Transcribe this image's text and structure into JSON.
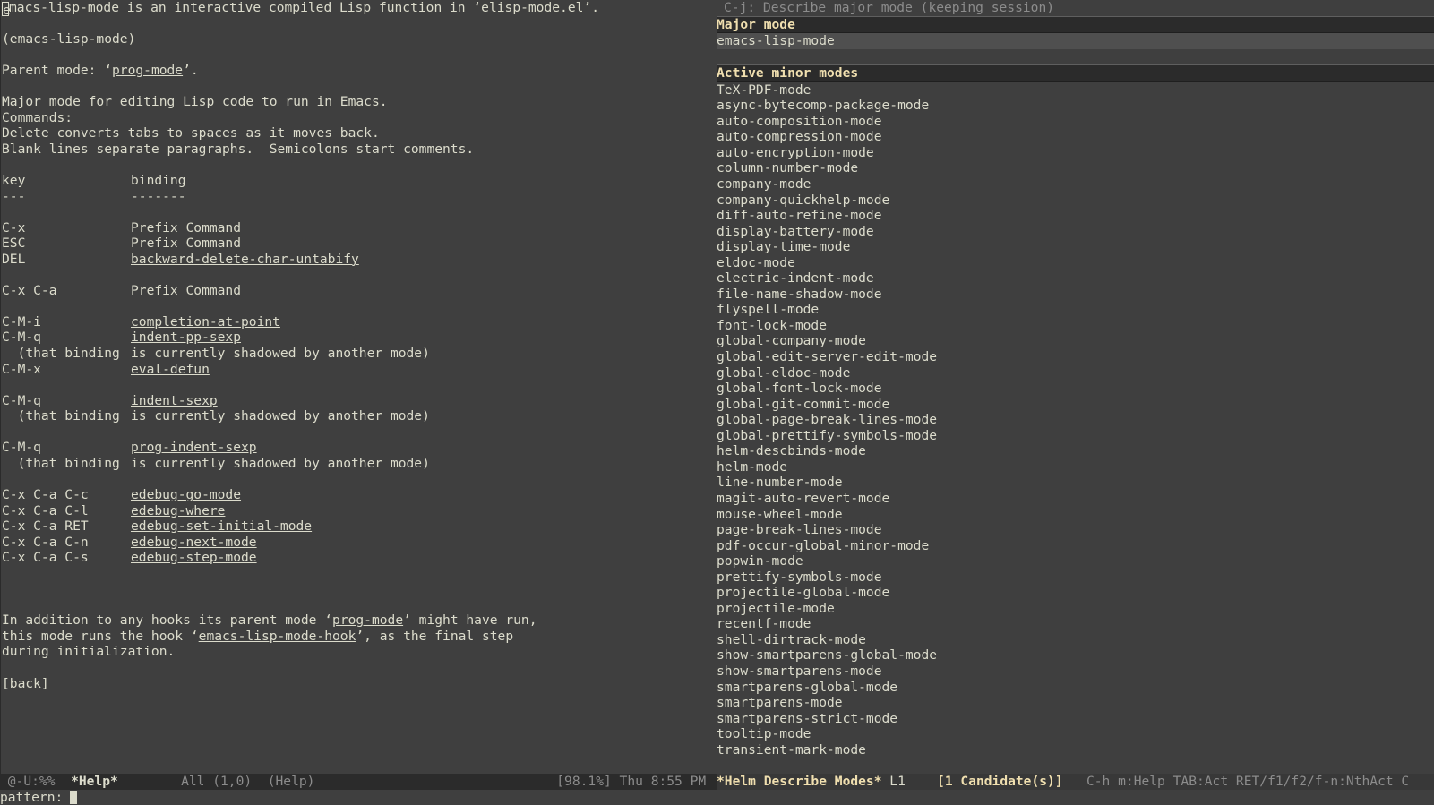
{
  "help": {
    "intro": {
      "cursor_char": "e",
      "pre": "macs-lisp-mode is an interactive compiled Lisp function in ‘",
      "file_link": "elisp-mode.el",
      "post": "’."
    },
    "signature": "(emacs-lisp-mode)",
    "parent": {
      "pre": "Parent mode: ‘",
      "link": "prog-mode",
      "post": "’."
    },
    "description": [
      "Major mode for editing Lisp code to run in Emacs.",
      "Commands:",
      "Delete converts tabs to spaces as it moves back.",
      "Blank lines separate paragraphs.  Semicolons start comments."
    ],
    "table_header": {
      "key": "key",
      "binding": "binding"
    },
    "table_rule": {
      "key": "---",
      "binding": "-------"
    },
    "rows": {
      "cx": {
        "key": "C-x",
        "binding": "Prefix Command"
      },
      "esc": {
        "key": "ESC",
        "binding": "Prefix Command"
      },
      "del": {
        "key": "DEL",
        "binding": "backward-delete-char-untabify"
      },
      "cxca": {
        "key": "C-x C-a",
        "binding": "Prefix Command"
      },
      "cmi": {
        "key": "C-M-i",
        "binding": "completion-at-point"
      },
      "cmq1": {
        "key": "C-M-q",
        "binding": "indent-pp-sexp"
      },
      "cmx": {
        "key": "C-M-x",
        "binding": "eval-defun"
      },
      "cmq2": {
        "key": "C-M-q",
        "binding": "indent-sexp"
      },
      "cmq3": {
        "key": "C-M-q",
        "binding": "prog-indent-sexp"
      },
      "cc": {
        "key": "C-x C-a C-c",
        "binding": "edebug-go-mode"
      },
      "cl": {
        "key": "C-x C-a C-l",
        "binding": "edebug-where"
      },
      "ret": {
        "key": "C-x C-a RET",
        "binding": "edebug-set-initial-mode"
      },
      "cn": {
        "key": "C-x C-a C-n",
        "binding": "edebug-next-mode"
      },
      "cs": {
        "key": "C-x C-a C-s",
        "binding": "edebug-step-mode"
      }
    },
    "shadow_note_left": "  (that binding",
    "shadow_note_right": "is currently shadowed by another mode)",
    "hooks": {
      "line1_pre": "In addition to any hooks its parent mode ‘",
      "line1_link": "prog-mode",
      "line1_post": "’ might have run,",
      "line2_pre": "this mode runs the hook ‘",
      "line2_link": "emacs-lisp-mode-hook",
      "line2_post": "’, as the final step",
      "line3": "during initialization."
    },
    "back_label": "[back]"
  },
  "helm": {
    "header": "C-j: Describe major mode (keeping session)",
    "major_section": "Major mode",
    "major_mode": "emacs-lisp-mode",
    "minor_section": "Active minor modes",
    "minor_modes": [
      "TeX-PDF-mode",
      "async-bytecomp-package-mode",
      "auto-composition-mode",
      "auto-compression-mode",
      "auto-encryption-mode",
      "column-number-mode",
      "company-mode",
      "company-quickhelp-mode",
      "diff-auto-refine-mode",
      "display-battery-mode",
      "display-time-mode",
      "eldoc-mode",
      "electric-indent-mode",
      "file-name-shadow-mode",
      "flyspell-mode",
      "font-lock-mode",
      "global-company-mode",
      "global-edit-server-edit-mode",
      "global-eldoc-mode",
      "global-font-lock-mode",
      "global-git-commit-mode",
      "global-page-break-lines-mode",
      "global-prettify-symbols-mode",
      "helm-descbinds-mode",
      "helm-mode",
      "line-number-mode",
      "magit-auto-revert-mode",
      "mouse-wheel-mode",
      "page-break-lines-mode",
      "pdf-occur-global-minor-mode",
      "popwin-mode",
      "prettify-symbols-mode",
      "projectile-global-mode",
      "projectile-mode",
      "recentf-mode",
      "shell-dirtrack-mode",
      "show-smartparens-global-mode",
      "show-smartparens-mode",
      "smartparens-global-mode",
      "smartparens-mode",
      "smartparens-strict-mode",
      "tooltip-mode",
      "transient-mark-mode"
    ]
  },
  "modeline": {
    "left_status": " @-U:%%  ",
    "left_buffer": "*Help*",
    "left_position": "        All (1,0)  (Help)",
    "left_misc": "[98.1%] Thu 8:55 PM ",
    "right_buffer": "*Helm Describe Modes*",
    "right_line": " L1    ",
    "right_candidates": "[1 Candidate(s)]",
    "right_help": "   C-h m:Help TAB:Act RET/f1/f2/f-n:NthAct C"
  },
  "minibuffer": {
    "prompt": "pattern:"
  },
  "colors": {
    "background": "#3f3f3f",
    "foreground": "#dcdccc",
    "section_header": "#f0dfaf",
    "modeline_bg": "#2b2b2b",
    "selection_bg": "#4f4f4f"
  }
}
